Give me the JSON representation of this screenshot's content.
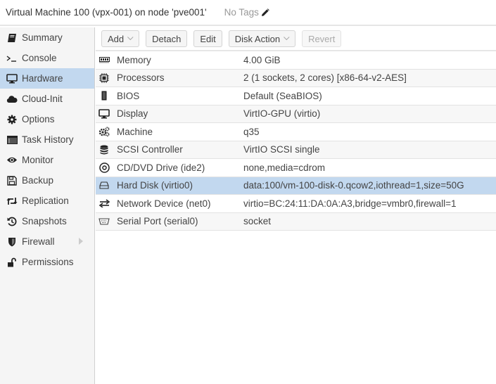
{
  "header": {
    "title": "Virtual Machine 100 (vpx-001) on node 'pve001'",
    "tags_label": "No Tags",
    "edit_icon": "pencil-icon"
  },
  "sidebar": {
    "items": [
      {
        "label": "Summary",
        "icon": "book-icon",
        "active": false
      },
      {
        "label": "Console",
        "icon": "terminal-icon",
        "active": false
      },
      {
        "label": "Hardware",
        "icon": "desktop-icon",
        "active": true
      },
      {
        "label": "Cloud-Init",
        "icon": "cloud-icon",
        "active": false
      },
      {
        "label": "Options",
        "icon": "gear-icon",
        "active": false
      },
      {
        "label": "Task History",
        "icon": "list-window-icon",
        "active": false
      },
      {
        "label": "Monitor",
        "icon": "eye-icon",
        "active": false
      },
      {
        "label": "Backup",
        "icon": "floppy-icon",
        "active": false
      },
      {
        "label": "Replication",
        "icon": "retweet-icon",
        "active": false
      },
      {
        "label": "Snapshots",
        "icon": "history-icon",
        "active": false
      },
      {
        "label": "Firewall",
        "icon": "shield-icon",
        "active": false,
        "expandable": true
      },
      {
        "label": "Permissions",
        "icon": "unlock-icon",
        "active": false
      }
    ]
  },
  "toolbar": {
    "add_label": "Add",
    "detach_label": "Detach",
    "edit_label": "Edit",
    "disk_action_label": "Disk Action",
    "revert_label": "Revert"
  },
  "hardware": {
    "rows": [
      {
        "name": "Memory",
        "value": "4.00 GiB",
        "icon": "memory-icon"
      },
      {
        "name": "Processors",
        "value": "2 (1 sockets, 2 cores) [x86-64-v2-AES]",
        "icon": "cpu-icon"
      },
      {
        "name": "BIOS",
        "value": "Default (SeaBIOS)",
        "icon": "microchip-icon"
      },
      {
        "name": "Display",
        "value": "VirtIO-GPU (virtio)",
        "icon": "desktop-icon"
      },
      {
        "name": "Machine",
        "value": "q35",
        "icon": "cogs-icon"
      },
      {
        "name": "SCSI Controller",
        "value": "VirtIO SCSI single",
        "icon": "database-icon"
      },
      {
        "name": "CD/DVD Drive (ide2)",
        "value": "none,media=cdrom",
        "icon": "cdrom-icon"
      },
      {
        "name": "Hard Disk (virtio0)",
        "value": "data:100/vm-100-disk-0.qcow2,iothread=1,size=50G",
        "icon": "hdd-icon",
        "selected": true
      },
      {
        "name": "Network Device (net0)",
        "value": "virtio=BC:24:11:DA:0A:A3,bridge=vmbr0,firewall=1",
        "icon": "exchange-icon"
      },
      {
        "name": "Serial Port (serial0)",
        "value": "socket",
        "icon": "serial-port-icon"
      }
    ]
  },
  "colors": {
    "selection": "#c2d8ef",
    "sidebar_bg": "#f5f5f5"
  }
}
